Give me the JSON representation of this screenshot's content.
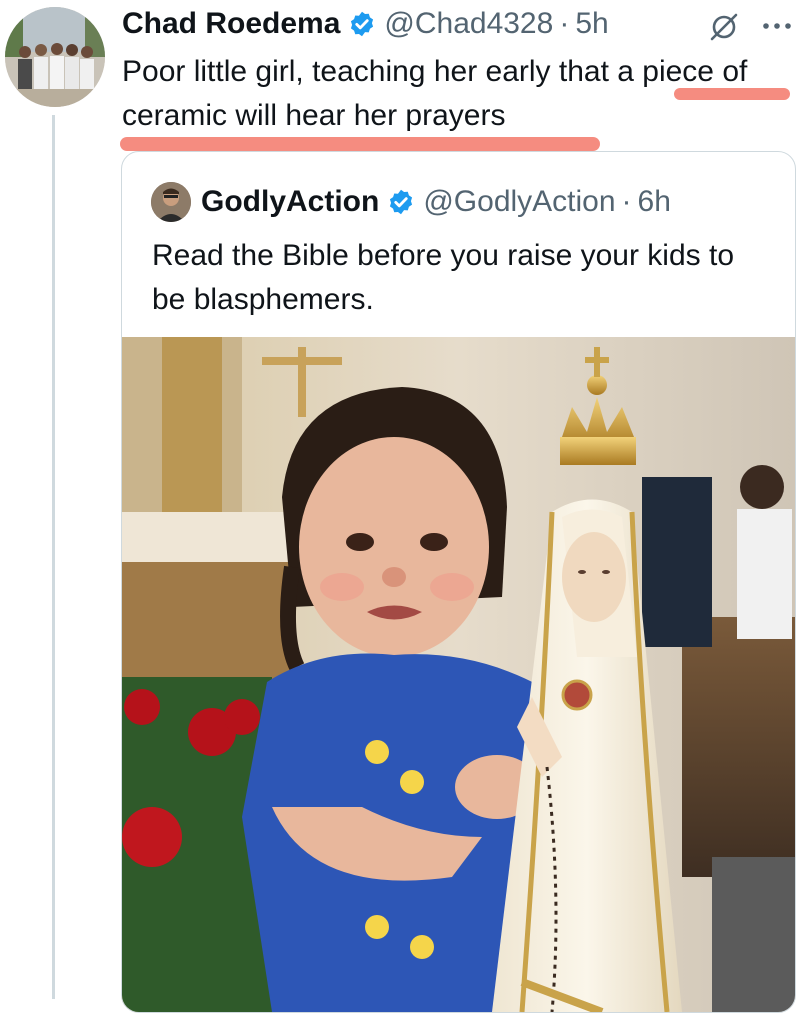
{
  "post": {
    "author_name": "Chad Roedema",
    "handle": "@Chad4328",
    "separator": "·",
    "time": "5h",
    "text": "Poor little girl, teaching her early that a piece of ceramic will hear her prayers",
    "verified_icon": "verified-badge-icon",
    "grok_icon": "grok-icon",
    "more_icon": "more-options-icon"
  },
  "quote": {
    "author_name": "GodlyAction",
    "handle": "@GodlyAction",
    "separator": "·",
    "time": "6h",
    "text": "Read the Bible before you raise your kids to be blasphemers.",
    "verified_icon": "verified-badge-icon"
  },
  "colors": {
    "verified_blue": "#1d9bf0",
    "highlight": "#f47f72",
    "secondary_text": "#536471",
    "border": "#cfd9de"
  }
}
